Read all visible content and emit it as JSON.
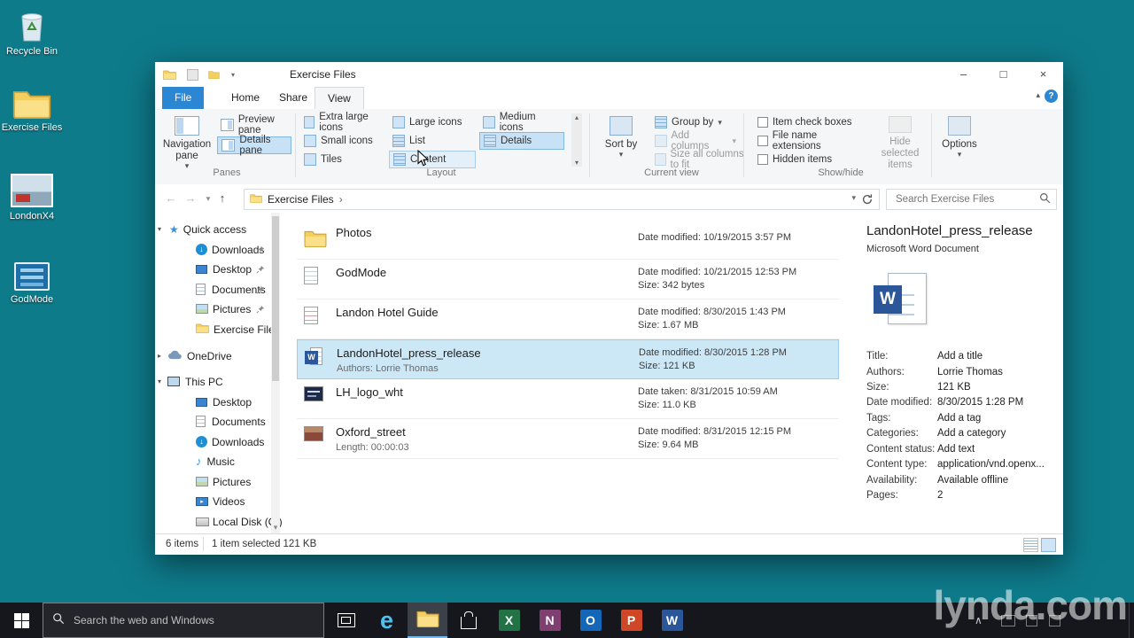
{
  "colors": {
    "desktop_teal": "#0e7b8b",
    "accent_blue": "#2b87d3",
    "selection_blue": "#cce8f7",
    "ribbon_bg": "#f5f6f7",
    "taskbar_dark": "#15171c",
    "word_blue": "#2b579a",
    "excel_green": "#217346",
    "onenote_purple": "#7f3f71",
    "outlook_blue": "#1466b8",
    "powerpoint_orange": "#d04727",
    "edge_blue": "#4cc2f1"
  },
  "glyphs": {
    "back": "←",
    "forward": "→",
    "up": "↑",
    "dropdown": "▾",
    "expand": "▸",
    "collapse": "▴",
    "scroll_down": "▾",
    "scroll_up": "▴",
    "star": "★",
    "music_note": "♪",
    "down_arrow": "↓",
    "play": "▸",
    "breadcrumb_chevron": "›",
    "tray_caret": "∧",
    "letter_w": "W",
    "letter_x": "X",
    "letter_n": "N",
    "letter_o": "O",
    "letter_p": "P",
    "letter_e": "e"
  },
  "desktop_icons": {
    "recycle_bin": "Recycle Bin",
    "exercise_files": "Exercise Files",
    "londonx4": "LondonX4",
    "godmode": "GodMode"
  },
  "explorer": {
    "title": "Exercise Files",
    "help_glyph": "?",
    "window_controls": {
      "minimize": "–",
      "maximize": "□",
      "close": "×"
    },
    "tabs": {
      "file": "File",
      "home": "Home",
      "share": "Share",
      "view": "View"
    },
    "ribbon": {
      "panes": {
        "group_label": "Panes",
        "navigation_pane": "Navigation pane",
        "preview_pane": "Preview pane",
        "details_pane": "Details pane"
      },
      "layout": {
        "group_label": "Layout",
        "extra_large_icons": "Extra large icons",
        "large_icons": "Large icons",
        "medium_icons": "Medium icons",
        "small_icons": "Small icons",
        "list": "List",
        "details": "Details",
        "tiles": "Tiles",
        "content": "Content"
      },
      "current_view": {
        "group_label": "Current view",
        "sort_by": "Sort by",
        "group_by": "Group by",
        "add_columns": "Add columns",
        "size_all_columns": "Size all columns to fit"
      },
      "show_hide": {
        "group_label": "Show/hide",
        "item_check_boxes": "Item check boxes",
        "file_name_extensions": "File name extensions",
        "hidden_items": "Hidden items",
        "hide_selected_items": "Hide selected items",
        "options": "Options"
      }
    },
    "address_bar": {
      "breadcrumb": "Exercise Files",
      "search_placeholder": "Search Exercise Files"
    },
    "nav": {
      "quick_access": "Quick access",
      "items_quick": [
        {
          "label": "Downloads"
        },
        {
          "label": "Desktop"
        },
        {
          "label": "Documents"
        },
        {
          "label": "Pictures"
        },
        {
          "label": "Exercise Files"
        }
      ],
      "onedrive": "OneDrive",
      "this_pc": "This PC",
      "items_pc": [
        {
          "label": "Desktop"
        },
        {
          "label": "Documents"
        },
        {
          "label": "Downloads"
        },
        {
          "label": "Music"
        },
        {
          "label": "Pictures"
        },
        {
          "label": "Videos"
        },
        {
          "label": "Local Disk (C:)"
        }
      ]
    },
    "files": [
      {
        "name": "Photos",
        "line2": "",
        "meta1": "Date modified: 10/19/2015 3:57 PM",
        "meta2": ""
      },
      {
        "name": "GodMode",
        "line2": "",
        "meta1": "Date modified: 10/21/2015 12:53 PM",
        "meta2": "Size: 342 bytes"
      },
      {
        "name": "Landon Hotel Guide",
        "line2": "",
        "meta1": "Date modified: 8/30/2015 1:43 PM",
        "meta2": "Size: 1.67 MB"
      },
      {
        "name": "LandonHotel_press_release",
        "line2": "Authors: Lorrie Thomas",
        "meta1": "Date modified: 8/30/2015 1:28 PM",
        "meta2": "Size: 121 KB"
      },
      {
        "name": "LH_logo_wht",
        "line2": "",
        "meta1": "Date taken: 8/31/2015 10:59 AM",
        "meta2": "Size: 11.0 KB"
      },
      {
        "name": "Oxford_street",
        "line2": "Length: 00:00:03",
        "meta1": "Date modified: 8/31/2015 12:15 PM",
        "meta2": "Size: 9.64 MB"
      }
    ],
    "details_pane": {
      "file_name": "LandonHotel_press_release",
      "file_type": "Microsoft Word Document",
      "fields": [
        {
          "label": "Title:",
          "value": "Add a title"
        },
        {
          "label": "Authors:",
          "value": "Lorrie Thomas"
        },
        {
          "label": "Size:",
          "value": "121 KB"
        },
        {
          "label": "Date modified:",
          "value": "8/30/2015 1:28 PM"
        },
        {
          "label": "Tags:",
          "value": "Add a tag"
        },
        {
          "label": "Categories:",
          "value": "Add a category"
        },
        {
          "label": "Content status:",
          "value": "Add text"
        },
        {
          "label": "Content type:",
          "value": "application/vnd.openx..."
        },
        {
          "label": "Availability:",
          "value": "Available offline"
        },
        {
          "label": "Pages:",
          "value": "2"
        }
      ]
    },
    "status_bar": {
      "items_count": "6 items",
      "selection_info": "1 item selected 121 KB"
    }
  },
  "taskbar": {
    "search_placeholder": "Search the web and Windows"
  },
  "watermark": "lynda.com"
}
